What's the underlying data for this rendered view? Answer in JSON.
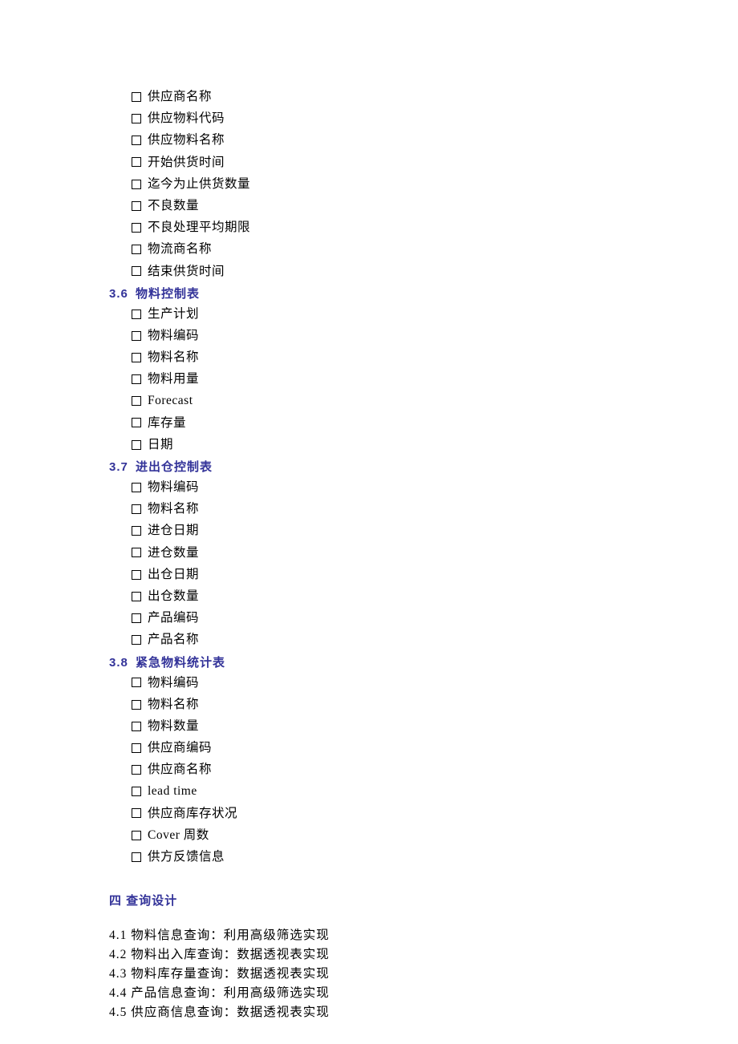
{
  "section_3_5_items": [
    "供应商名称",
    "供应物料代码",
    "供应物料名称",
    "开始供货时间",
    "迄今为止供货数量",
    "不良数量",
    "不良处理平均期限",
    "物流商名称",
    "结束供货时间"
  ],
  "section_3_6": {
    "num": "3.6",
    "title": "物料控制表"
  },
  "section_3_6_items": [
    "生产计划",
    "物料编码",
    "物料名称",
    "物料用量",
    "Forecast",
    "库存量",
    "日期"
  ],
  "section_3_7": {
    "num": "3.7",
    "title": "进出仓控制表"
  },
  "section_3_7_items": [
    "物料编码",
    "物料名称",
    "进仓日期",
    "进仓数量",
    "出仓日期",
    "出仓数量",
    "产品编码",
    "产品名称"
  ],
  "section_3_8": {
    "num": "3.8",
    "title": "紧急物料统计表"
  },
  "section_3_8_items": [
    "物料编码",
    "物料名称",
    "物料数量",
    "供应商编码",
    "供应商名称",
    "lead time",
    "供应商库存状况",
    "Cover 周数",
    "供方反馈信息"
  ],
  "section_4_title": "四 查询设计",
  "section_4_items": [
    "4.1 物料信息查询：利用高级筛选实现",
    "4.2 物料出入库查询：数据透视表实现",
    "4.3 物料库存量查询：数据透视表实现",
    "4.4 产品信息查询：利用高级筛选实现",
    "4.5 供应商信息查询：数据透视表实现"
  ]
}
